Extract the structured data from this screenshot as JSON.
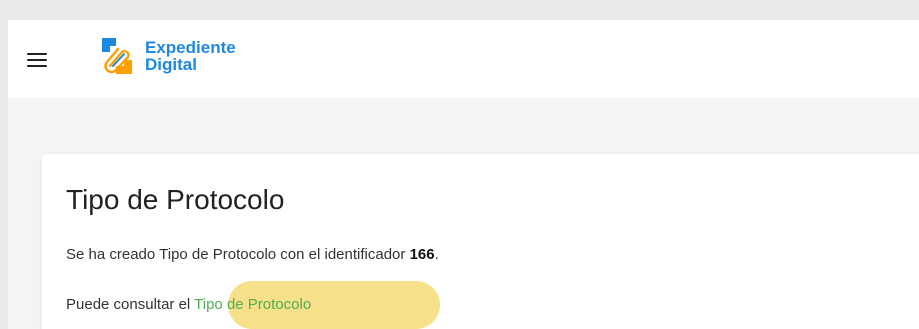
{
  "header": {
    "menu_icon": "hamburger-menu-icon",
    "logo": {
      "line1": "Expediente",
      "line2": "Digital",
      "colors": {
        "blue": "#1e88e5",
        "orange": "#ffa000"
      }
    }
  },
  "card": {
    "title": "Tipo de Protocolo",
    "message_prefix": "Se ha creado Tipo de Protocolo con el identificador",
    "identifier": "166",
    "message_suffix": ".",
    "consult_prefix": "Puede consultar el",
    "consult_link": "Tipo de Protocolo"
  },
  "colors": {
    "link": "#4caf50",
    "highlight": "#f6e08a"
  }
}
